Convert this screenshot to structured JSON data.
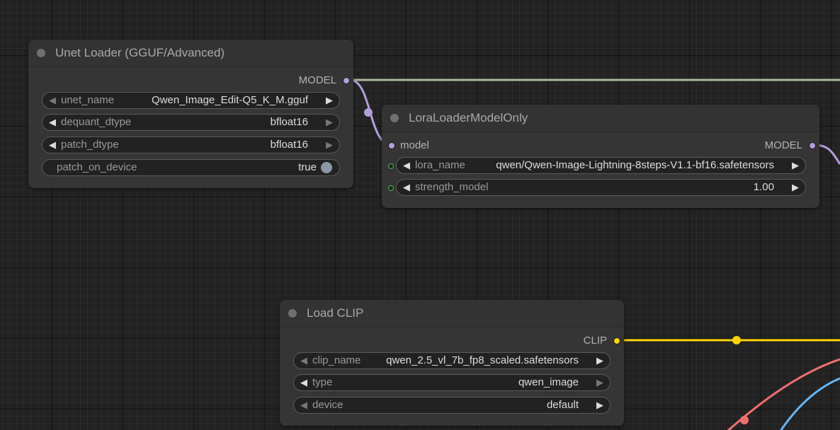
{
  "colors": {
    "model_link": "#b39ddb",
    "clip_link": "#ffd500",
    "model_link_straight": "#a9b99f",
    "red_link": "#ef6f6f",
    "blue_link": "#64b5f6"
  },
  "nodes": {
    "unet_loader": {
      "title": "Unet Loader (GGUF/Advanced)",
      "output_label": "MODEL",
      "widgets": [
        {
          "name": "unet_name",
          "value": "Qwen_Image_Edit-Q5_K_M.gguf"
        },
        {
          "name": "dequant_dtype",
          "value": "bfloat16"
        },
        {
          "name": "patch_dtype",
          "value": "bfloat16"
        },
        {
          "name": "patch_on_device",
          "value": "true"
        }
      ]
    },
    "lora_loader": {
      "title": "LoraLoaderModelOnly",
      "input_label": "model",
      "output_label": "MODEL",
      "widgets": [
        {
          "name": "lora_name",
          "value": "qwen/Qwen-Image-Lightning-8steps-V1.1-bf16.safetensors"
        },
        {
          "name": "strength_model",
          "value": "1.00"
        }
      ]
    },
    "load_clip": {
      "title": "Load CLIP",
      "output_label": "CLIP",
      "widgets": [
        {
          "name": "clip_name",
          "value": "qwen_2.5_vl_7b_fp8_scaled.safetensors"
        },
        {
          "name": "type",
          "value": "qwen_image"
        },
        {
          "name": "device",
          "value": "default"
        }
      ]
    }
  }
}
